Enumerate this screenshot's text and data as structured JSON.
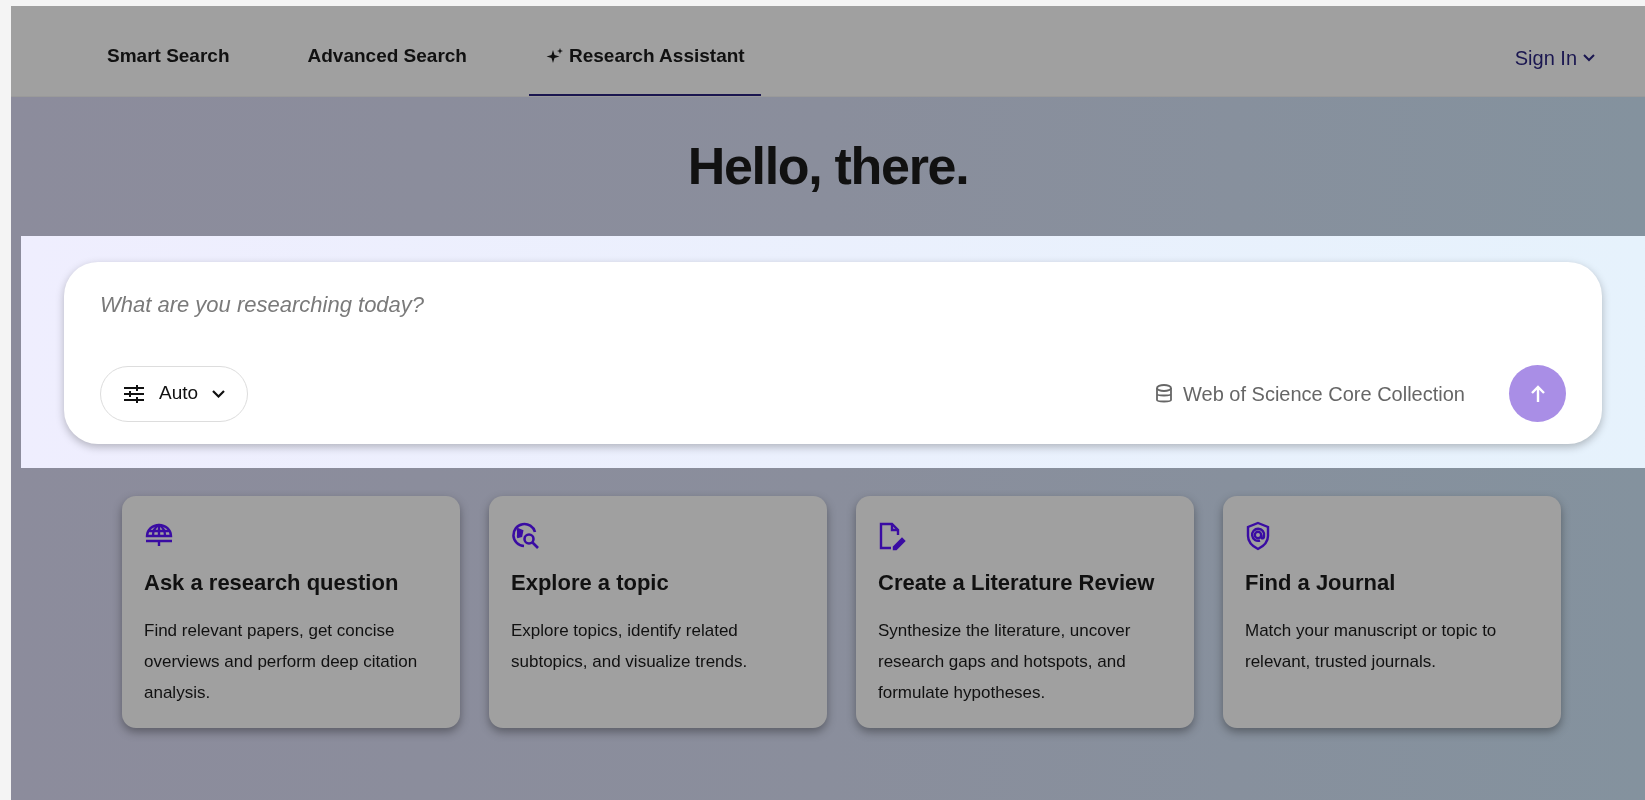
{
  "nav": {
    "tabs": [
      {
        "label": "Smart Search",
        "selected": false,
        "kind": "plain"
      },
      {
        "label": "Advanced Search",
        "selected": false,
        "kind": "plain"
      },
      {
        "label": "Research Assistant",
        "selected": true,
        "kind": "assistant"
      }
    ],
    "sign_in": "Sign In"
  },
  "heading": "Hello, there.",
  "search": {
    "placeholder": "What are you researching today?",
    "mode": "Auto",
    "collection": "Web of Science Core Collection"
  },
  "cards": [
    {
      "kind": "question",
      "title": "Ask a research question",
      "description": "Find relevant papers, get concise overviews and perform deep citation analysis."
    },
    {
      "kind": "topic",
      "title": "Explore a topic",
      "description": "Explore topics, identify related subtopics, and visualize trends."
    },
    {
      "kind": "review",
      "title": "Create a Literature Review",
      "description": "Synthesize the literature, uncover research gaps and hotspots, and formulate hypotheses."
    },
    {
      "kind": "journal",
      "title": "Find a Journal",
      "description": "Match your manuscript or topic to relevant, trusted journals."
    }
  ]
}
